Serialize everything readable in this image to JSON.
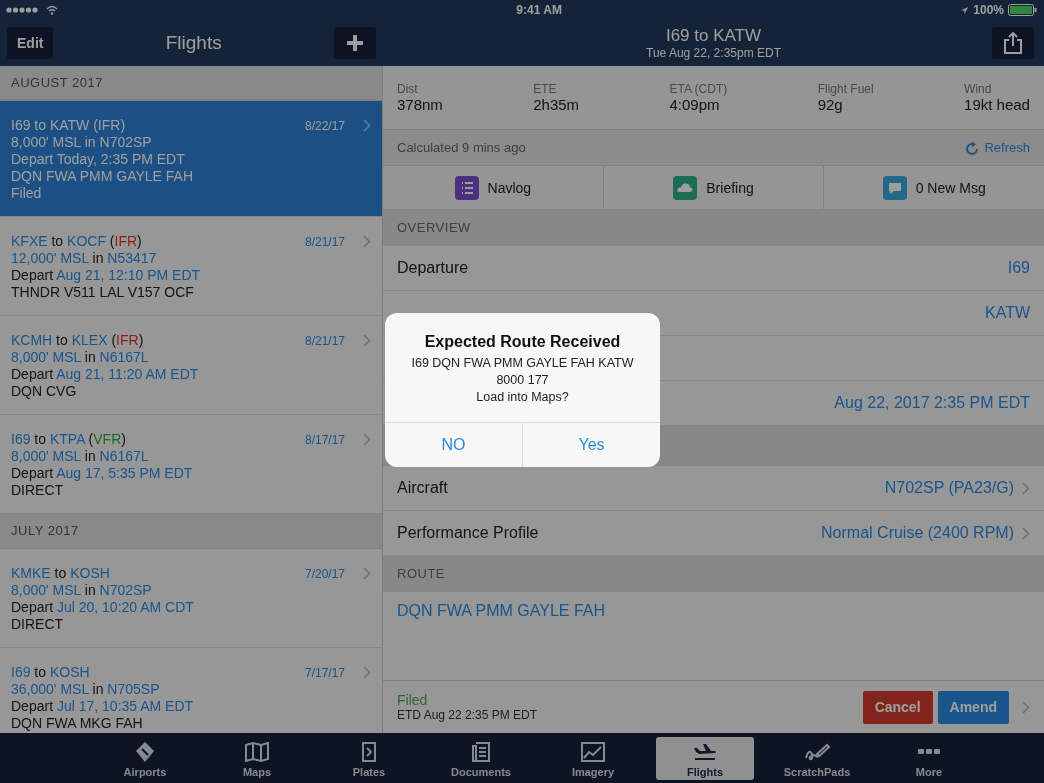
{
  "status_bar": {
    "time": "9:41 AM",
    "battery": "100%"
  },
  "sidebar": {
    "title": "Flights",
    "edit": "Edit",
    "sections": [
      {
        "header": "AUGUST 2017",
        "flights": [
          {
            "selected": true,
            "date": "8/22/17",
            "lines": [
              [
                {
                  "text": "I69 to KATW (IFR)"
                }
              ],
              [
                {
                  "text": "8,000' MSL in N702SP"
                }
              ],
              [
                {
                  "text": "Depart Today, 2:35 PM EDT"
                }
              ],
              [
                {
                  "text": "DQN FWA PMM GAYLE FAH"
                }
              ],
              [
                {
                  "text": "Filed"
                }
              ]
            ]
          },
          {
            "selected": false,
            "date": "8/21/17",
            "lines": [
              [
                {
                  "text": "KFXE",
                  "kind": "link"
                },
                {
                  "text": " to ",
                  "kind": "plain"
                },
                {
                  "text": "KOCF",
                  "kind": "link"
                },
                {
                  "text": " (",
                  "kind": "plain"
                },
                {
                  "text": "IFR",
                  "kind": "ifr"
                },
                {
                  "text": ")",
                  "kind": "plain"
                }
              ],
              [
                {
                  "text": "12,000' MSL",
                  "kind": "link"
                },
                {
                  "text": " in ",
                  "kind": "plain"
                },
                {
                  "text": "N53417",
                  "kind": "link"
                }
              ],
              [
                {
                  "text": "Depart ",
                  "kind": "plain"
                },
                {
                  "text": "Aug 21, 12:10 PM EDT",
                  "kind": "link"
                }
              ],
              [
                {
                  "text": "THNDR V511 LAL V157 OCF",
                  "kind": "plain"
                }
              ]
            ]
          },
          {
            "selected": false,
            "date": "8/21/17",
            "lines": [
              [
                {
                  "text": "KCMH",
                  "kind": "link"
                },
                {
                  "text": " to ",
                  "kind": "plain"
                },
                {
                  "text": "KLEX",
                  "kind": "link"
                },
                {
                  "text": " (",
                  "kind": "plain"
                },
                {
                  "text": "IFR",
                  "kind": "ifr"
                },
                {
                  "text": ")",
                  "kind": "plain"
                }
              ],
              [
                {
                  "text": "8,000' MSL",
                  "kind": "link"
                },
                {
                  "text": " in ",
                  "kind": "plain"
                },
                {
                  "text": "N6167L",
                  "kind": "link"
                }
              ],
              [
                {
                  "text": "Depart ",
                  "kind": "plain"
                },
                {
                  "text": "Aug 21, 11:20 AM EDT",
                  "kind": "link"
                }
              ],
              [
                {
                  "text": "DQN CVG",
                  "kind": "plain"
                }
              ]
            ]
          },
          {
            "selected": false,
            "date": "8/17/17",
            "lines": [
              [
                {
                  "text": "I69",
                  "kind": "link"
                },
                {
                  "text": " to ",
                  "kind": "plain"
                },
                {
                  "text": "KTPA",
                  "kind": "link"
                },
                {
                  "text": " (",
                  "kind": "plain"
                },
                {
                  "text": "VFR",
                  "kind": "vfr"
                },
                {
                  "text": ")",
                  "kind": "plain"
                }
              ],
              [
                {
                  "text": "8,000' MSL",
                  "kind": "link"
                },
                {
                  "text": " in ",
                  "kind": "plain"
                },
                {
                  "text": "N6167L",
                  "kind": "link"
                }
              ],
              [
                {
                  "text": "Depart ",
                  "kind": "plain"
                },
                {
                  "text": "Aug 17, 5:35 PM EDT",
                  "kind": "link"
                }
              ],
              [
                {
                  "text": "DIRECT",
                  "kind": "plain"
                }
              ]
            ]
          }
        ]
      },
      {
        "header": "JULY 2017",
        "flights": [
          {
            "selected": false,
            "date": "7/20/17",
            "lines": [
              [
                {
                  "text": "KMKE",
                  "kind": "link"
                },
                {
                  "text": " to ",
                  "kind": "plain"
                },
                {
                  "text": "KOSH",
                  "kind": "link"
                }
              ],
              [
                {
                  "text": "8,000' MSL",
                  "kind": "link"
                },
                {
                  "text": " in ",
                  "kind": "plain"
                },
                {
                  "text": "N702SP",
                  "kind": "link"
                }
              ],
              [
                {
                  "text": "Depart ",
                  "kind": "plain"
                },
                {
                  "text": "Jul 20, 10:20 AM CDT",
                  "kind": "link"
                }
              ],
              [
                {
                  "text": "DIRECT",
                  "kind": "plain"
                }
              ]
            ]
          },
          {
            "selected": false,
            "date": "7/17/17",
            "lines": [
              [
                {
                  "text": "I69",
                  "kind": "link"
                },
                {
                  "text": " to ",
                  "kind": "plain"
                },
                {
                  "text": "KOSH",
                  "kind": "link"
                }
              ],
              [
                {
                  "text": "36,000' MSL",
                  "kind": "link"
                },
                {
                  "text": " in ",
                  "kind": "plain"
                },
                {
                  "text": "N705SP",
                  "kind": "link"
                }
              ],
              [
                {
                  "text": "Depart ",
                  "kind": "plain"
                },
                {
                  "text": "Jul 17, 10:35 AM EDT",
                  "kind": "link"
                }
              ],
              [
                {
                  "text": "DQN FWA MKG FAH",
                  "kind": "plain"
                }
              ]
            ]
          }
        ]
      }
    ]
  },
  "detail": {
    "title": "I69 to KATW",
    "subtitle": "Tue Aug 22, 2:35pm EDT",
    "stats": [
      {
        "label": "Dist",
        "value": "378nm"
      },
      {
        "label": "ETE",
        "value": "2h35m"
      },
      {
        "label": "ETA (CDT)",
        "value": "4:09pm"
      },
      {
        "label": "Flight Fuel",
        "value": "92g"
      },
      {
        "label": "Wind",
        "value": "19kt head"
      }
    ],
    "calculated": "Calculated 9 mins ago",
    "refresh": "Refresh",
    "actions": [
      {
        "kind": "navlog",
        "label": "Navlog"
      },
      {
        "kind": "briefing",
        "label": "Briefing"
      },
      {
        "kind": "messages",
        "label": "0 New Msg"
      }
    ],
    "overview_header": "OVERVIEW",
    "rows": [
      {
        "kind": "row",
        "label": "Departure",
        "value": "I69",
        "chevron": false
      },
      {
        "kind": "row",
        "value": "KATW",
        "chevron": false
      },
      {
        "kind": "row",
        "chevron": false
      },
      {
        "kind": "row",
        "value": "Aug 22, 2017 2:35 PM EDT",
        "chevron": false
      },
      {
        "kind": "band"
      },
      {
        "kind": "row",
        "label": "Aircraft",
        "value": "N702SP (PA23/G)",
        "chevron": true
      },
      {
        "kind": "row",
        "label": "Performance Profile",
        "value": "Normal Cruise (2400 RPM)",
        "chevron": true
      }
    ],
    "route_header": "ROUTE",
    "route": "DQN FWA PMM GAYLE FAH",
    "footer": {
      "status": "Filed",
      "etd": "ETD Aug 22 2:35 PM EDT",
      "cancel": "Cancel",
      "amend": "Amend"
    }
  },
  "tabs": [
    {
      "kind": "airports",
      "label": "Airports",
      "selected": false
    },
    {
      "kind": "maps",
      "label": "Maps",
      "selected": false
    },
    {
      "kind": "plates",
      "label": "Plates",
      "selected": false
    },
    {
      "kind": "documents",
      "label": "Documents",
      "selected": false
    },
    {
      "kind": "imagery",
      "label": "Imagery",
      "selected": false
    },
    {
      "kind": "flights",
      "label": "Flights",
      "selected": true
    },
    {
      "kind": "scratchpads",
      "label": "ScratchPads",
      "selected": false
    },
    {
      "kind": "more",
      "label": "More",
      "selected": false
    }
  ],
  "dialog": {
    "title": "Expected Route Received",
    "lines": [
      "I69 DQN FWA PMM GAYLE FAH KATW",
      "8000 177",
      "Load into Maps?"
    ],
    "buttons": [
      "NO",
      "Yes"
    ]
  }
}
